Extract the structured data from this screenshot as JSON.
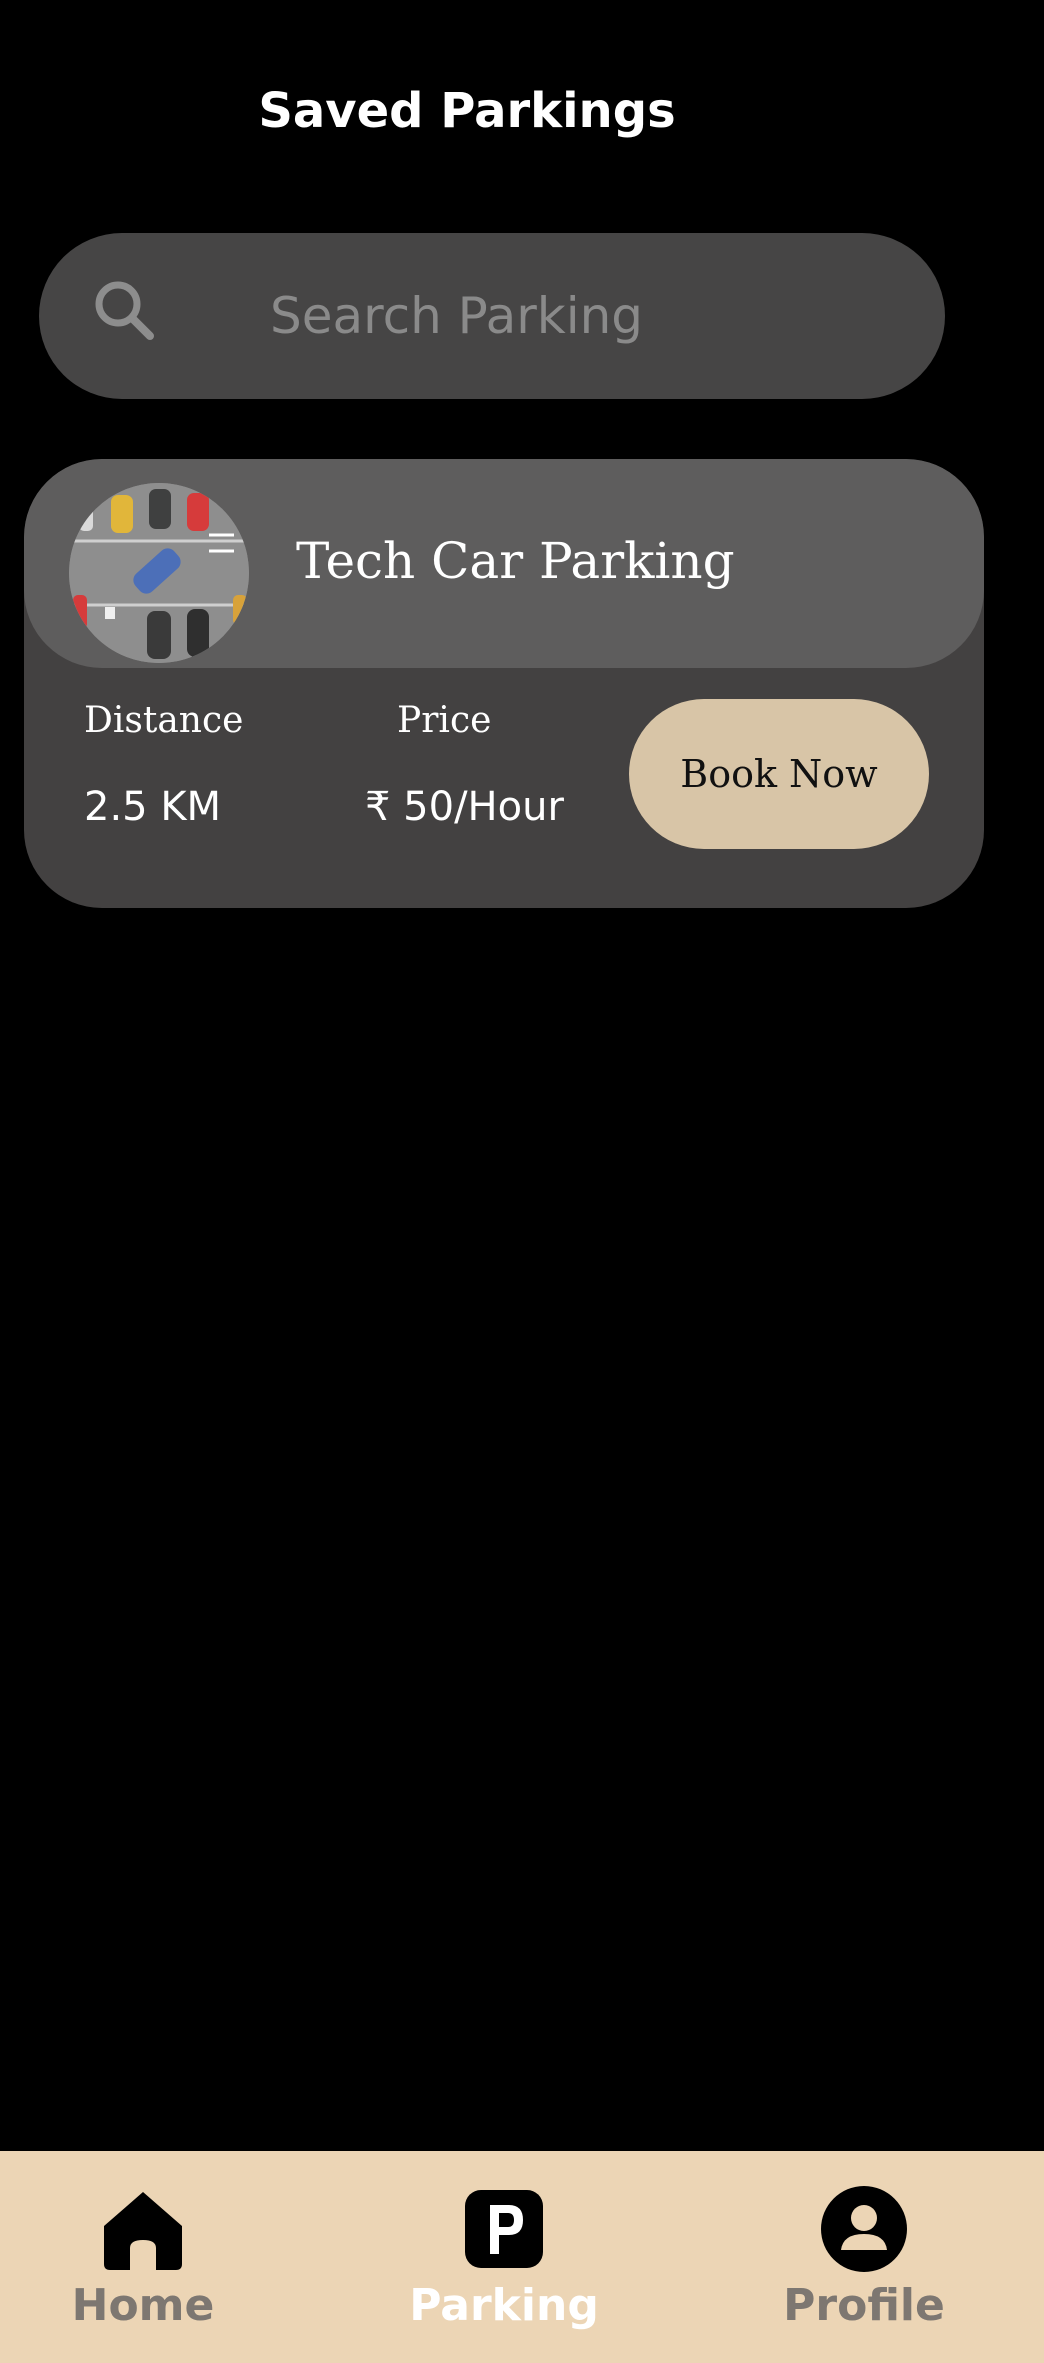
{
  "header": {
    "title": "Saved Parkings"
  },
  "search": {
    "placeholder": "Search Parking",
    "icon": "search-icon"
  },
  "parking_card": {
    "name": "Tech Car Parking",
    "distance_label": "Distance",
    "distance_value": "2.5 KM",
    "price_label": "Price",
    "price_value": "₹ 50/Hour",
    "book_label": "Book Now"
  },
  "bottom_nav": {
    "items": [
      {
        "label": "Home",
        "icon": "home-icon",
        "active": false
      },
      {
        "label": "Parking",
        "icon": "parking-icon",
        "active": true
      },
      {
        "label": "Profile",
        "icon": "profile-icon",
        "active": false
      }
    ]
  },
  "colors": {
    "background": "#000000",
    "search_bg": "#464545",
    "card_bg": "#434141",
    "card_header_bg": "#5e5d5d",
    "book_button_bg": "#d8c5a7",
    "nav_bg": "#ecd5b5",
    "nav_inactive": "#7d7771",
    "nav_active": "#ffffff"
  }
}
